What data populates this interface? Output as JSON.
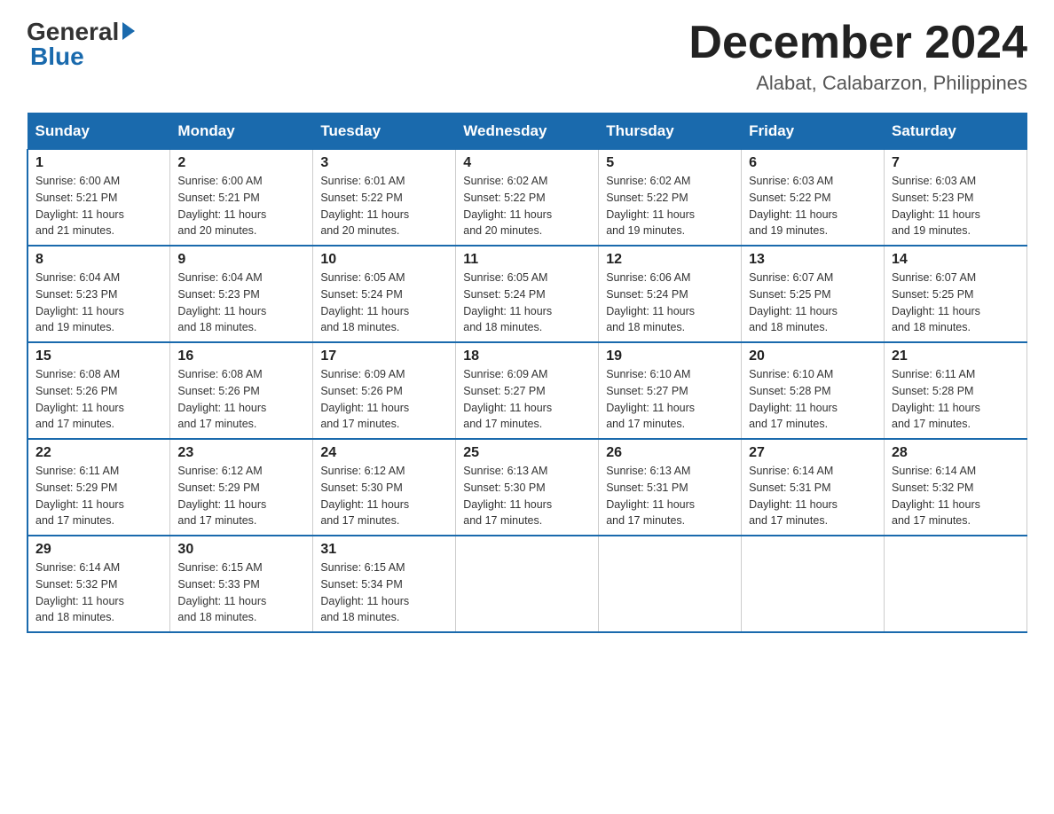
{
  "header": {
    "logo_general": "General",
    "logo_blue": "Blue",
    "month_title": "December 2024",
    "location": "Alabat, Calabarzon, Philippines"
  },
  "days_of_week": [
    "Sunday",
    "Monday",
    "Tuesday",
    "Wednesday",
    "Thursday",
    "Friday",
    "Saturday"
  ],
  "weeks": [
    [
      {
        "day": "1",
        "sunrise": "6:00 AM",
        "sunset": "5:21 PM",
        "daylight": "11 hours and 21 minutes."
      },
      {
        "day": "2",
        "sunrise": "6:00 AM",
        "sunset": "5:21 PM",
        "daylight": "11 hours and 20 minutes."
      },
      {
        "day": "3",
        "sunrise": "6:01 AM",
        "sunset": "5:22 PM",
        "daylight": "11 hours and 20 minutes."
      },
      {
        "day": "4",
        "sunrise": "6:02 AM",
        "sunset": "5:22 PM",
        "daylight": "11 hours and 20 minutes."
      },
      {
        "day": "5",
        "sunrise": "6:02 AM",
        "sunset": "5:22 PM",
        "daylight": "11 hours and 19 minutes."
      },
      {
        "day": "6",
        "sunrise": "6:03 AM",
        "sunset": "5:22 PM",
        "daylight": "11 hours and 19 minutes."
      },
      {
        "day": "7",
        "sunrise": "6:03 AM",
        "sunset": "5:23 PM",
        "daylight": "11 hours and 19 minutes."
      }
    ],
    [
      {
        "day": "8",
        "sunrise": "6:04 AM",
        "sunset": "5:23 PM",
        "daylight": "11 hours and 19 minutes."
      },
      {
        "day": "9",
        "sunrise": "6:04 AM",
        "sunset": "5:23 PM",
        "daylight": "11 hours and 18 minutes."
      },
      {
        "day": "10",
        "sunrise": "6:05 AM",
        "sunset": "5:24 PM",
        "daylight": "11 hours and 18 minutes."
      },
      {
        "day": "11",
        "sunrise": "6:05 AM",
        "sunset": "5:24 PM",
        "daylight": "11 hours and 18 minutes."
      },
      {
        "day": "12",
        "sunrise": "6:06 AM",
        "sunset": "5:24 PM",
        "daylight": "11 hours and 18 minutes."
      },
      {
        "day": "13",
        "sunrise": "6:07 AM",
        "sunset": "5:25 PM",
        "daylight": "11 hours and 18 minutes."
      },
      {
        "day": "14",
        "sunrise": "6:07 AM",
        "sunset": "5:25 PM",
        "daylight": "11 hours and 18 minutes."
      }
    ],
    [
      {
        "day": "15",
        "sunrise": "6:08 AM",
        "sunset": "5:26 PM",
        "daylight": "11 hours and 17 minutes."
      },
      {
        "day": "16",
        "sunrise": "6:08 AM",
        "sunset": "5:26 PM",
        "daylight": "11 hours and 17 minutes."
      },
      {
        "day": "17",
        "sunrise": "6:09 AM",
        "sunset": "5:26 PM",
        "daylight": "11 hours and 17 minutes."
      },
      {
        "day": "18",
        "sunrise": "6:09 AM",
        "sunset": "5:27 PM",
        "daylight": "11 hours and 17 minutes."
      },
      {
        "day": "19",
        "sunrise": "6:10 AM",
        "sunset": "5:27 PM",
        "daylight": "11 hours and 17 minutes."
      },
      {
        "day": "20",
        "sunrise": "6:10 AM",
        "sunset": "5:28 PM",
        "daylight": "11 hours and 17 minutes."
      },
      {
        "day": "21",
        "sunrise": "6:11 AM",
        "sunset": "5:28 PM",
        "daylight": "11 hours and 17 minutes."
      }
    ],
    [
      {
        "day": "22",
        "sunrise": "6:11 AM",
        "sunset": "5:29 PM",
        "daylight": "11 hours and 17 minutes."
      },
      {
        "day": "23",
        "sunrise": "6:12 AM",
        "sunset": "5:29 PM",
        "daylight": "11 hours and 17 minutes."
      },
      {
        "day": "24",
        "sunrise": "6:12 AM",
        "sunset": "5:30 PM",
        "daylight": "11 hours and 17 minutes."
      },
      {
        "day": "25",
        "sunrise": "6:13 AM",
        "sunset": "5:30 PM",
        "daylight": "11 hours and 17 minutes."
      },
      {
        "day": "26",
        "sunrise": "6:13 AM",
        "sunset": "5:31 PM",
        "daylight": "11 hours and 17 minutes."
      },
      {
        "day": "27",
        "sunrise": "6:14 AM",
        "sunset": "5:31 PM",
        "daylight": "11 hours and 17 minutes."
      },
      {
        "day": "28",
        "sunrise": "6:14 AM",
        "sunset": "5:32 PM",
        "daylight": "11 hours and 17 minutes."
      }
    ],
    [
      {
        "day": "29",
        "sunrise": "6:14 AM",
        "sunset": "5:32 PM",
        "daylight": "11 hours and 18 minutes."
      },
      {
        "day": "30",
        "sunrise": "6:15 AM",
        "sunset": "5:33 PM",
        "daylight": "11 hours and 18 minutes."
      },
      {
        "day": "31",
        "sunrise": "6:15 AM",
        "sunset": "5:34 PM",
        "daylight": "11 hours and 18 minutes."
      },
      null,
      null,
      null,
      null
    ]
  ],
  "labels": {
    "sunrise": "Sunrise:",
    "sunset": "Sunset:",
    "daylight": "Daylight:"
  }
}
